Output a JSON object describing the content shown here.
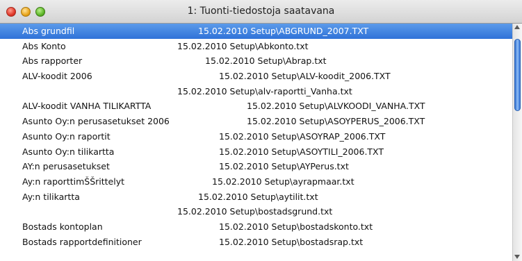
{
  "window": {
    "title": "1: Tuonti-tiedostoja saatavana"
  },
  "list": {
    "selected_index": 0,
    "rows": [
      {
        "name": "Abs grundfil",
        "info": "15.02.2010  Setup\\ABGRUND_2007.TXT"
      },
      {
        "name": "Abs Konto",
        "info": "15.02.2010  Setup\\Abkonto.txt"
      },
      {
        "name": "Abs rapporter",
        "info": "15.02.2010  Setup\\Abrap.txt"
      },
      {
        "name": "ALV-koodit 2006",
        "info": "15.02.2010  Setup\\ALV-koodit_2006.TXT"
      },
      {
        "name": "",
        "info": "15.02.2010  Setup\\alv-raportti_Vanha.txt"
      },
      {
        "name": "ALV-koodit VANHA TILIKARTTA",
        "info": "15.02.2010  Setup\\ALVKOODI_VANHA.TXT"
      },
      {
        "name": "Asunto Oy:n perusasetukset 2006",
        "info": "15.02.2010  Setup\\ASOYPERUS_2006.TXT"
      },
      {
        "name": "Asunto Oy:n raportit",
        "info": "15.02.2010  Setup\\ASOYRAP_2006.TXT"
      },
      {
        "name": "Asunto Oy:n tilikartta",
        "info": "15.02.2010  Setup\\ASOYTILI_2006.TXT"
      },
      {
        "name": "AY:n perusasetukset",
        "info": "15.02.2010  Setup\\AYPerus.txt"
      },
      {
        "name": "Ay:n raporttimŠŠrittelyt",
        "info": "15.02.2010  Setup\\ayrapmaar.txt"
      },
      {
        "name": "Ay:n tilikartta",
        "info": "15.02.2010  Setup\\aytilit.txt"
      },
      {
        "name": "",
        "info": "15.02.2010  Setup\\bostadsgrund.txt"
      },
      {
        "name": "Bostads kontoplan",
        "info": "15.02.2010  Setup\\bostadskonto.txt"
      },
      {
        "name": "Bostads rapportdefinitioner",
        "info": "15.02.2010  Setup\\bostadsrap.txt"
      }
    ]
  },
  "colors": {
    "selection": "#2f72d8",
    "selected_text": "#ffffff",
    "scroll_thumb": "#3575d8"
  }
}
